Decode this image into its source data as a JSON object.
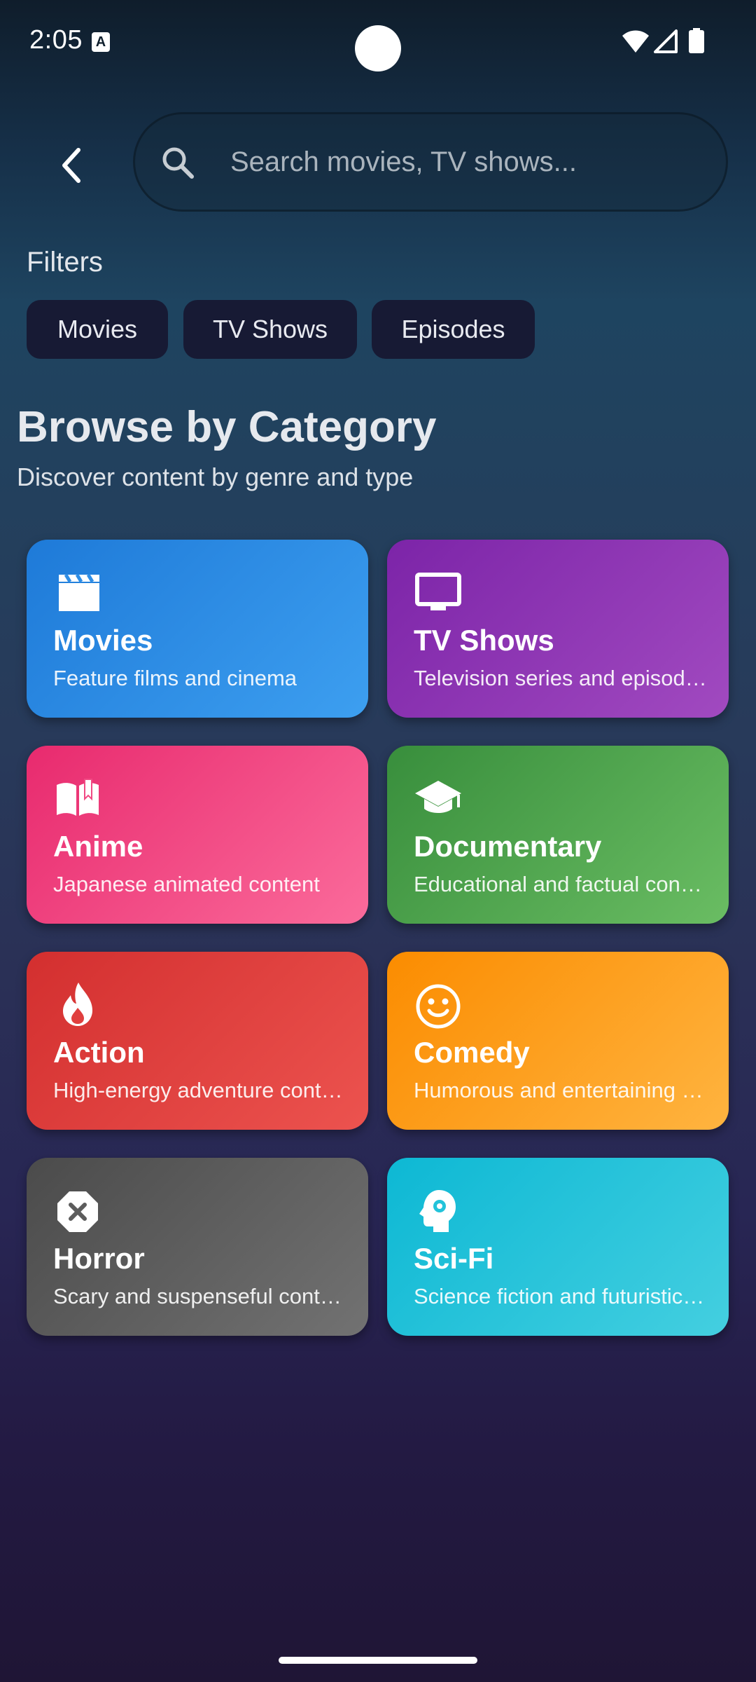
{
  "status_bar": {
    "time": "2:05",
    "notification_icon_letter": "A"
  },
  "search": {
    "placeholder": "Search movies, TV shows..."
  },
  "filters": {
    "title": "Filters",
    "chips": [
      "Movies",
      "TV Shows",
      "Episodes"
    ]
  },
  "section": {
    "title": "Browse by Category",
    "subtitle": "Discover content by genre and type"
  },
  "categories": [
    {
      "title": "Movies",
      "description": "Feature films and cinema",
      "icon": "clapperboard-icon",
      "color": "#2f8ee6"
    },
    {
      "title": "TV Shows",
      "description": "Television series and episodes",
      "icon": "tv-icon",
      "color": "#8e36b3"
    },
    {
      "title": "Anime",
      "description": "Japanese animated content",
      "icon": "book-open-icon",
      "color": "#f14a84"
    },
    {
      "title": "Documentary",
      "description": "Educational and factual content",
      "icon": "graduation-cap-icon",
      "color": "#4fa550"
    },
    {
      "title": "Action",
      "description": "High-energy adventure content",
      "icon": "flame-icon",
      "color": "#e03f3e"
    },
    {
      "title": "Comedy",
      "description": "Humorous and entertaining content",
      "icon": "smiley-icon",
      "color": "#fd9f1e"
    },
    {
      "title": "Horror",
      "description": "Scary and suspenseful content",
      "icon": "cancel-octagon-icon",
      "color": "#5c5c5c"
    },
    {
      "title": "Sci-Fi",
      "description": "Science fiction and futuristic content",
      "icon": "psychology-head-icon",
      "color": "#22c3da"
    }
  ]
}
